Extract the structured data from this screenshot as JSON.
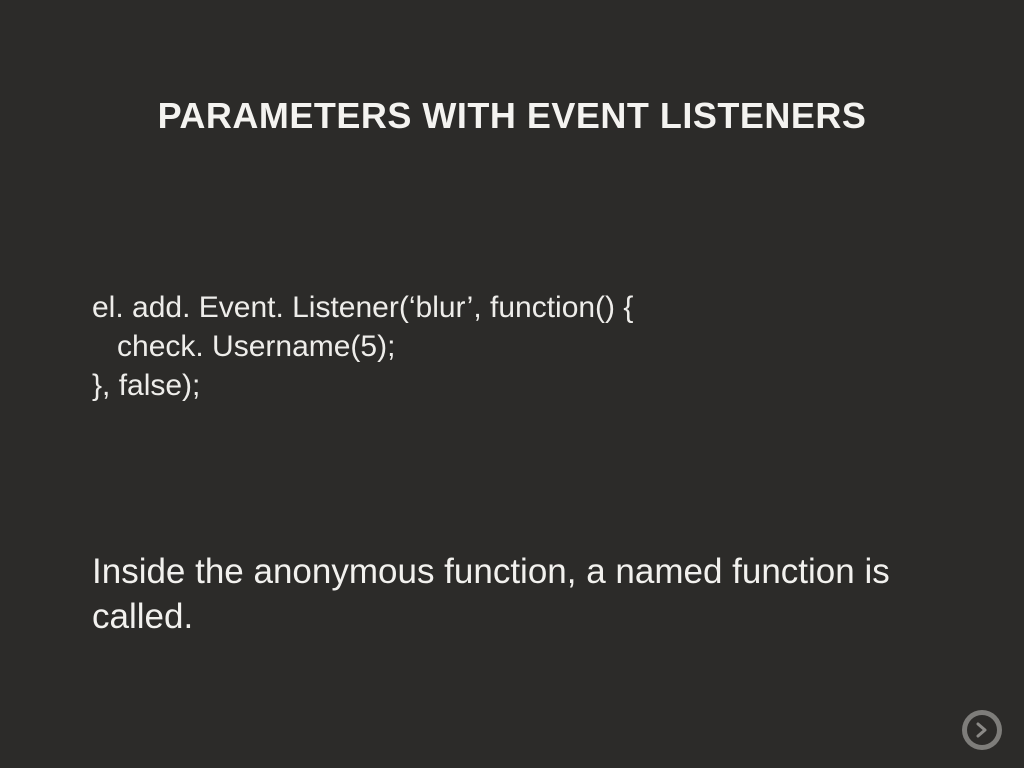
{
  "slide": {
    "title": "PARAMETERS WITH EVENT LISTENERS",
    "code": {
      "line1": "el. add. Event. Listener(‘blur’, function() {",
      "line2": "   check. Username(5);",
      "line3": "}, false);"
    },
    "body": "Inside the anonymous function, a named function is called."
  }
}
